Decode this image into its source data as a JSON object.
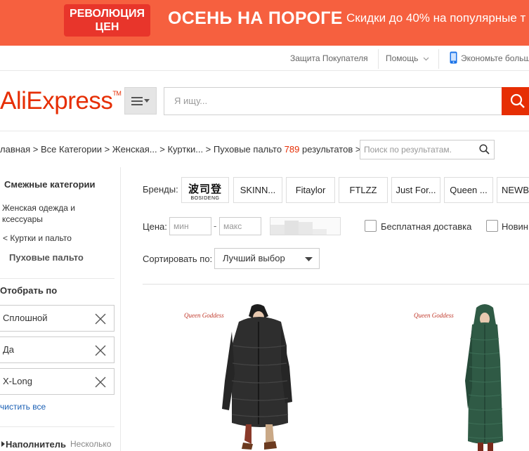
{
  "banner": {
    "badge_line1": "РЕВОЛЮЦИЯ",
    "badge_line2": "ЦЕН",
    "title": "ОСЕНЬ НА ПОРОГЕ",
    "subtitle": "Скидки до 40% на популярные т",
    "bg_color": "#f6603f",
    "badge_color": "#e8352b"
  },
  "topnav": {
    "buyer_protection": "Защита Покупателя",
    "help": "Помощь",
    "app": "Экономьте больш"
  },
  "header": {
    "logo": "AliExpress",
    "logo_mark": "TM",
    "search_placeholder": "Я ищу...",
    "brand_color": "#e62e04"
  },
  "breadcrumb": {
    "path": "лавная > Все Категории > Женская... > Куртки... > Пуховые пальто ",
    "count": "789",
    "results_label": " результатов >",
    "search_in_results_placeholder": "Поиск по результатам."
  },
  "sidebar": {
    "related_heading": "Смежные категории",
    "cat_women_line1": "Женская одежда и",
    "cat_women_line2": "ксессуары",
    "cat_jackets": "< Куртки и пальто",
    "cat_current": "Пуховые пальто",
    "selected_heading": "Отобрать по",
    "selected_filters": [
      "Сплошной",
      "Да",
      "X-Long"
    ],
    "clear_all": "чистить все",
    "filler_heading": "Наполнитель",
    "filler_value": "Несколько"
  },
  "filters": {
    "brands_label": "Бренды:",
    "brands": [
      "SKINN...",
      "Fitaylor",
      "FTLZZ",
      "Just For...",
      "Queen ...",
      "NEWBA"
    ],
    "brand_logo_cn": "波司登",
    "brand_logo_en": "BOSIDENG",
    "price_label": "Цена:",
    "price_min_placeholder": "мин",
    "price_max_placeholder": "макс",
    "price_sep": "-",
    "free_shipping": "Бесплатная доставка",
    "new_items": "Новин",
    "sort_label": "Сортировать по:",
    "sort_value": "Лучший выбор"
  },
  "products": [
    {
      "brand_mark": "Queen Goddess",
      "coat_color": "#2e2e2e"
    },
    {
      "brand_mark": "Queen Goddess",
      "coat_color": "#2f5a45"
    }
  ]
}
